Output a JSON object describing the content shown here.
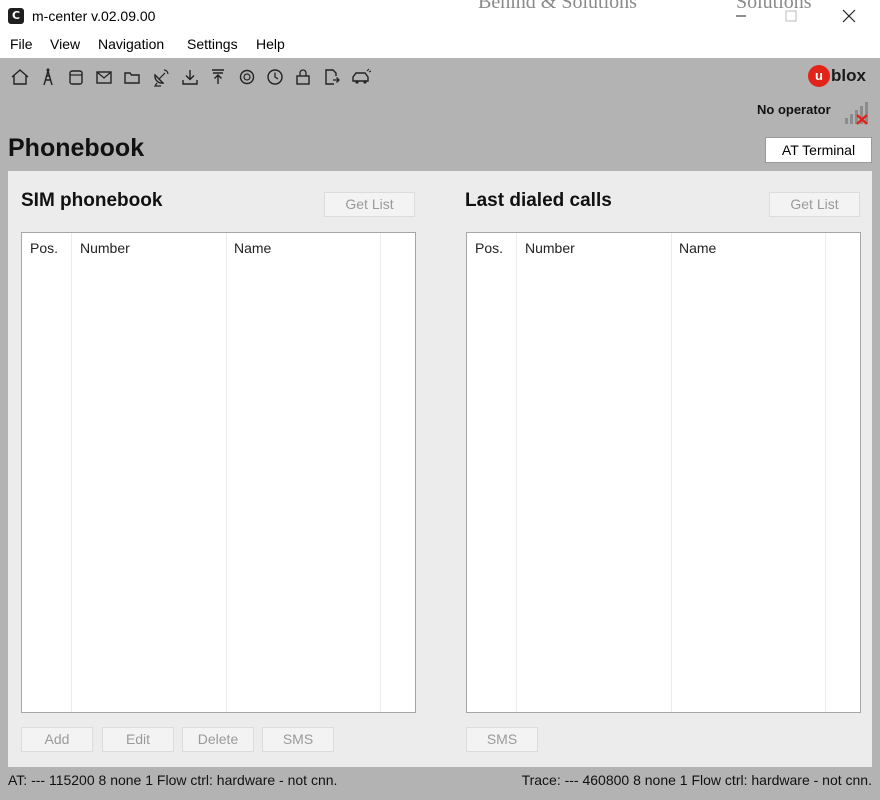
{
  "window": {
    "app_icon": "C",
    "title": "m-center v.02.09.00",
    "background_text_1": "Behind & Solutions",
    "background_text_2": "Solutions",
    "minimize_icon": "minimize-icon",
    "maximize_icon": "maximize-icon",
    "close_icon": "close-icon"
  },
  "menu": {
    "file": "File",
    "view": "View",
    "navigation": "Navigation",
    "settings": "Settings",
    "help": "Help"
  },
  "toolbar": {
    "icons": [
      "home-icon",
      "antenna-tower-icon",
      "sim-card-icon",
      "envelope-icon",
      "folder-icon",
      "satellite-dish-icon",
      "download-icon",
      "upload-icon",
      "gear-icon",
      "clock-icon",
      "padlock-icon",
      "document-export-icon",
      "car-icon"
    ]
  },
  "brand": {
    "logo_mark": "u",
    "logo_text": "blox",
    "accent_color": "#e2231a"
  },
  "status": {
    "operator": "No operator"
  },
  "page": {
    "title": "Phonebook",
    "at_terminal_label": "AT Terminal"
  },
  "sim_phonebook": {
    "title": "SIM phonebook",
    "get_list_label": "Get List",
    "columns": [
      "Pos.",
      "Number",
      "Name"
    ],
    "rows": [],
    "buttons": {
      "add": "Add",
      "edit": "Edit",
      "delete": "Delete",
      "sms": "SMS"
    }
  },
  "last_dialed": {
    "title": "Last dialed calls",
    "get_list_label": "Get List",
    "columns": [
      "Pos.",
      "Number",
      "Name"
    ],
    "rows": [],
    "buttons": {
      "sms": "SMS"
    }
  },
  "statusbar": {
    "at": "AT: --- 115200 8 none 1 Flow ctrl: hardware - not cnn.",
    "trace": "Trace: --- 460800 8 none 1 Flow ctrl: hardware - not cnn."
  }
}
